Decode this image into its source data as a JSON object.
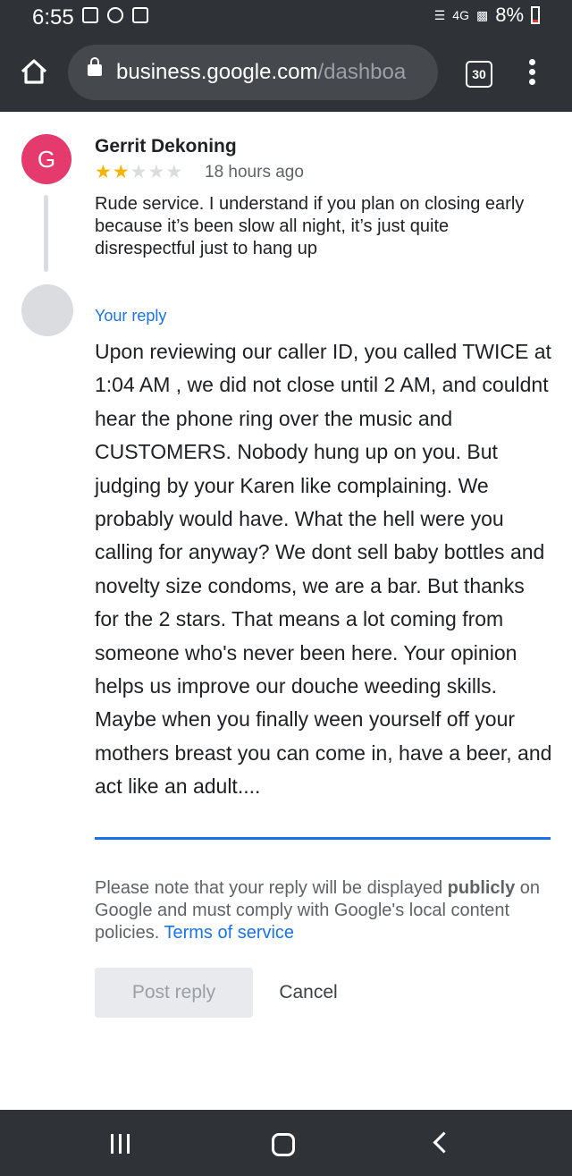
{
  "status_bar": {
    "time": "6:55",
    "network": "4G",
    "battery": "8%"
  },
  "browser": {
    "url_host": "business.google.com",
    "url_path": "/dashboa",
    "tab_count": "30"
  },
  "review": {
    "avatar_letter": "G",
    "avatar_color": "#e53a6e",
    "author": "Gerrit Dekoning",
    "rating": 2,
    "rating_max": 5,
    "time": "18 hours ago",
    "text": "Rude service. I understand if you plan on closing early because it’s been slow all night, it’s just quite disrespectful just to hang up"
  },
  "reply": {
    "label": "Your reply",
    "text": "Upon reviewing our caller ID, you called TWICE at 1:04 AM , we did not close until 2 AM, and couldnt hear the phone ring over the music and CUSTOMERS. Nobody hung up on you. But judging by your Karen like complaining. We probably would have. What the hell were you calling for anyway? We dont sell baby bottles and novelty size condoms, we are a bar. But thanks for the 2 stars. That means a lot coming from someone who's never been here. Your opinion helps us improve our douche weeding skills. Maybe when you finally ween yourself off your mothers breast you can come in, have a beer, and act like an adult....",
    "note_before": "Please note that your reply will be displayed ",
    "note_bold": "publicly",
    "note_after": " on Google and must comply with Google's local content policies. ",
    "tos_link": "Terms of service",
    "post_label": "Post reply",
    "cancel_label": "Cancel"
  },
  "colors": {
    "accent": "#1a73e8",
    "star": "#f4b400",
    "chrome_bar": "#2f3236"
  }
}
